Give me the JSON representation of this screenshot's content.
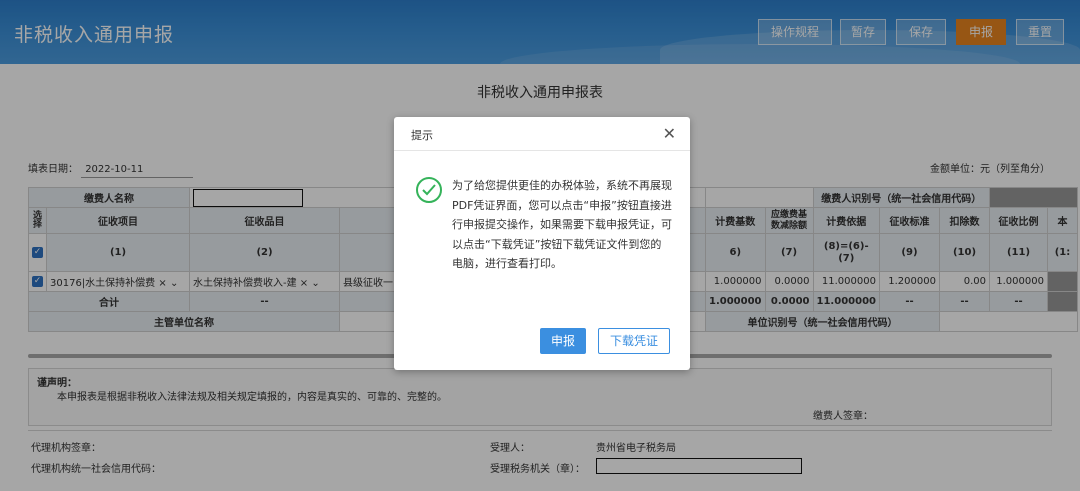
{
  "header": {
    "title": "非税收入通用申报",
    "buttons": {
      "guide": "操作规程",
      "draft": "暂存",
      "save": "保存",
      "submit": "申报",
      "reset": "重置"
    }
  },
  "form": {
    "title": "非税收入通用申报表",
    "fill_date_label": "填表日期：",
    "fill_date": "2022-10-11",
    "unit_note": "金额单位：元（列至角分）",
    "payer_name_label": "缴费人名称",
    "payer_id_label": "缴费人识别号（统一社会信用代码）",
    "columns": {
      "select": "选择",
      "project": "征收项目",
      "item": "征收品目",
      "base": "计费基数",
      "deduct_base": "应缴费基数减除额",
      "basis": "计费依据",
      "standard": "征收标准",
      "deduction": "扣除数",
      "ratio": "征收比例",
      "more": "本"
    },
    "col_numbers": {
      "c1": "(1)",
      "c2": "(2)",
      "c6": "6)",
      "c7": "(7)",
      "c8": "(8)=(6)-(7)",
      "c9": "(9)",
      "c10": "(10)",
      "c11": "(11)",
      "c12": "(1:"
    },
    "row": {
      "project": "30176|水土保持补偿费",
      "item": "水土保持补偿费收入-建",
      "extra": "县级征收一",
      "base": "1.000000",
      "deduct_base": "0.0000",
      "basis": "11.000000",
      "standard": "1.200000",
      "deduction": "0.00",
      "ratio": "1.000000"
    },
    "total": {
      "label": "合计",
      "item": "--",
      "base": "1.000000",
      "deduct_base": "0.0000",
      "basis": "11.000000",
      "standard": "--",
      "deduction": "--",
      "ratio": "--"
    },
    "authority_label": "主管单位名称",
    "authority_id_label": "单位识别号（统一社会信用代码）"
  },
  "declaration": {
    "heading": "谨声明：",
    "text": "本申报表是根据非税收入法律法规及相关规定填报的，内容是真实的、可靠的、完整的。",
    "payer_sign": "缴费人签章："
  },
  "bottom": {
    "agency_seal": "代理机构签章：",
    "agency_code": "代理机构统一社会信用代码：",
    "receiver_label": "受理人：",
    "receiver_value": "贵州省电子税务局",
    "tax_office_label": "受理税务机关（章）："
  },
  "modal": {
    "title": "提示",
    "message": "为了给您提供更佳的办税体验，系统不再展现PDF凭证界面，您可以点击“申报”按钮直接进行申报提交操作，如果需要下载申报凭证，可以点击“下载凭证”按钮下载凭证文件到您的电脑，进行查看打印。",
    "submit": "申报",
    "download": "下载凭证"
  },
  "colors": {
    "header_blue": "#3a8fd8",
    "accent_orange": "#e8841f",
    "modal_blue": "#3b8fe0",
    "success_green": "#35b35a"
  }
}
